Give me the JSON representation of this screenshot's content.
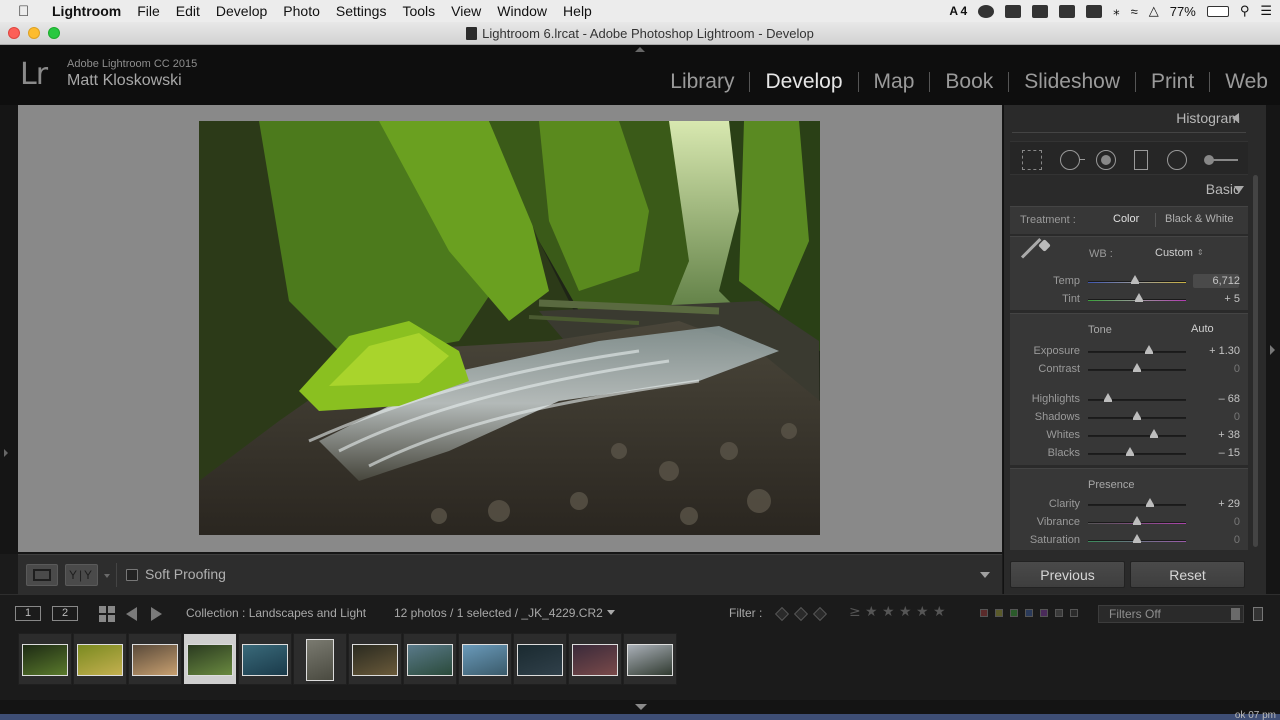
{
  "menubar": {
    "app_name": "Lightroom",
    "items": [
      "File",
      "Edit",
      "Develop",
      "Photo",
      "Settings",
      "Tools",
      "View",
      "Window",
      "Help"
    ],
    "status": {
      "adobe_count": "4",
      "battery": "77%"
    }
  },
  "window": {
    "title": "Lightroom 6.lrcat - Adobe Photoshop Lightroom - Develop"
  },
  "identity": {
    "logo": "Lr",
    "product": "Adobe Lightroom CC 2015",
    "user": "Matt Kloskowski"
  },
  "modules": {
    "items": [
      "Library",
      "Develop",
      "Map",
      "Book",
      "Slideshow",
      "Print",
      "Web"
    ],
    "active": "Develop"
  },
  "toolbar": {
    "compare_label": "Y|Y",
    "soft_proofing_label": "Soft Proofing",
    "soft_proofing_checked": false
  },
  "right_panel": {
    "histogram_label": "Histogram",
    "basic_label": "Basic",
    "treatment": {
      "label": "Treatment :",
      "options": [
        "Color",
        "Black & White"
      ],
      "selected": "Color"
    },
    "wb": {
      "label": "WB :",
      "value": "Custom"
    },
    "wb_sliders": [
      {
        "label": "Temp",
        "value": "6,712",
        "position": 0.48
      },
      {
        "label": "Tint",
        "value": "+ 5",
        "position": 0.52
      }
    ],
    "tone": {
      "label": "Tone",
      "auto_label": "Auto",
      "sliders": [
        {
          "label": "Exposure",
          "value": "+ 1.30",
          "position": 0.62
        },
        {
          "label": "Contrast",
          "value": "0",
          "position": 0.5
        },
        {
          "label": "Highlights",
          "value": "– 68",
          "position": 0.2
        },
        {
          "label": "Shadows",
          "value": "0",
          "position": 0.5
        },
        {
          "label": "Whites",
          "value": "+ 38",
          "position": 0.67
        },
        {
          "label": "Blacks",
          "value": "– 15",
          "position": 0.43
        }
      ]
    },
    "presence": {
      "label": "Presence",
      "sliders": [
        {
          "label": "Clarity",
          "value": "+ 29",
          "position": 0.63
        },
        {
          "label": "Vibrance",
          "value": "0",
          "position": 0.5
        },
        {
          "label": "Saturation",
          "value": "0",
          "position": 0.5
        }
      ]
    },
    "previous_label": "Previous",
    "reset_label": "Reset"
  },
  "filmstrip_header": {
    "page1": "1",
    "page2": "2",
    "collection": "Collection : Landscapes and Light",
    "count": "12 photos / 1 selected / _JK_4229.CR2",
    "filter_label": "Filter :",
    "filters_value": "Filters Off"
  },
  "filmstrip": {
    "selected_index": 3,
    "thumbnails": [
      {
        "colors": [
          "#1d2a14",
          "#5a7a2c"
        ],
        "portrait": false
      },
      {
        "colors": [
          "#7a8a20",
          "#c4b050"
        ],
        "portrait": false
      },
      {
        "colors": [
          "#5a4a3a",
          "#c8a070"
        ],
        "portrait": false
      },
      {
        "colors": [
          "#2a3a20",
          "#6a8a40"
        ],
        "portrait": false
      },
      {
        "colors": [
          "#3a6a7a",
          "#1a3a4a"
        ],
        "portrait": false
      },
      {
        "colors": [
          "#7a7a70",
          "#4a4a40"
        ],
        "portrait": true
      },
      {
        "colors": [
          "#2a2a20",
          "#6a5a3a"
        ],
        "portrait": false
      },
      {
        "colors": [
          "#5a7a8a",
          "#2a4a3a"
        ],
        "portrait": false
      },
      {
        "colors": [
          "#6a9aba",
          "#3a5a6a"
        ],
        "portrait": false
      },
      {
        "colors": [
          "#1a2a30",
          "#30404a"
        ],
        "portrait": false
      },
      {
        "colors": [
          "#3a2a3a",
          "#7a4a4a"
        ],
        "portrait": false
      },
      {
        "colors": [
          "#aab0b8",
          "#303a30"
        ],
        "portrait": false
      }
    ]
  },
  "clock_fragment": "ok 07 pm"
}
